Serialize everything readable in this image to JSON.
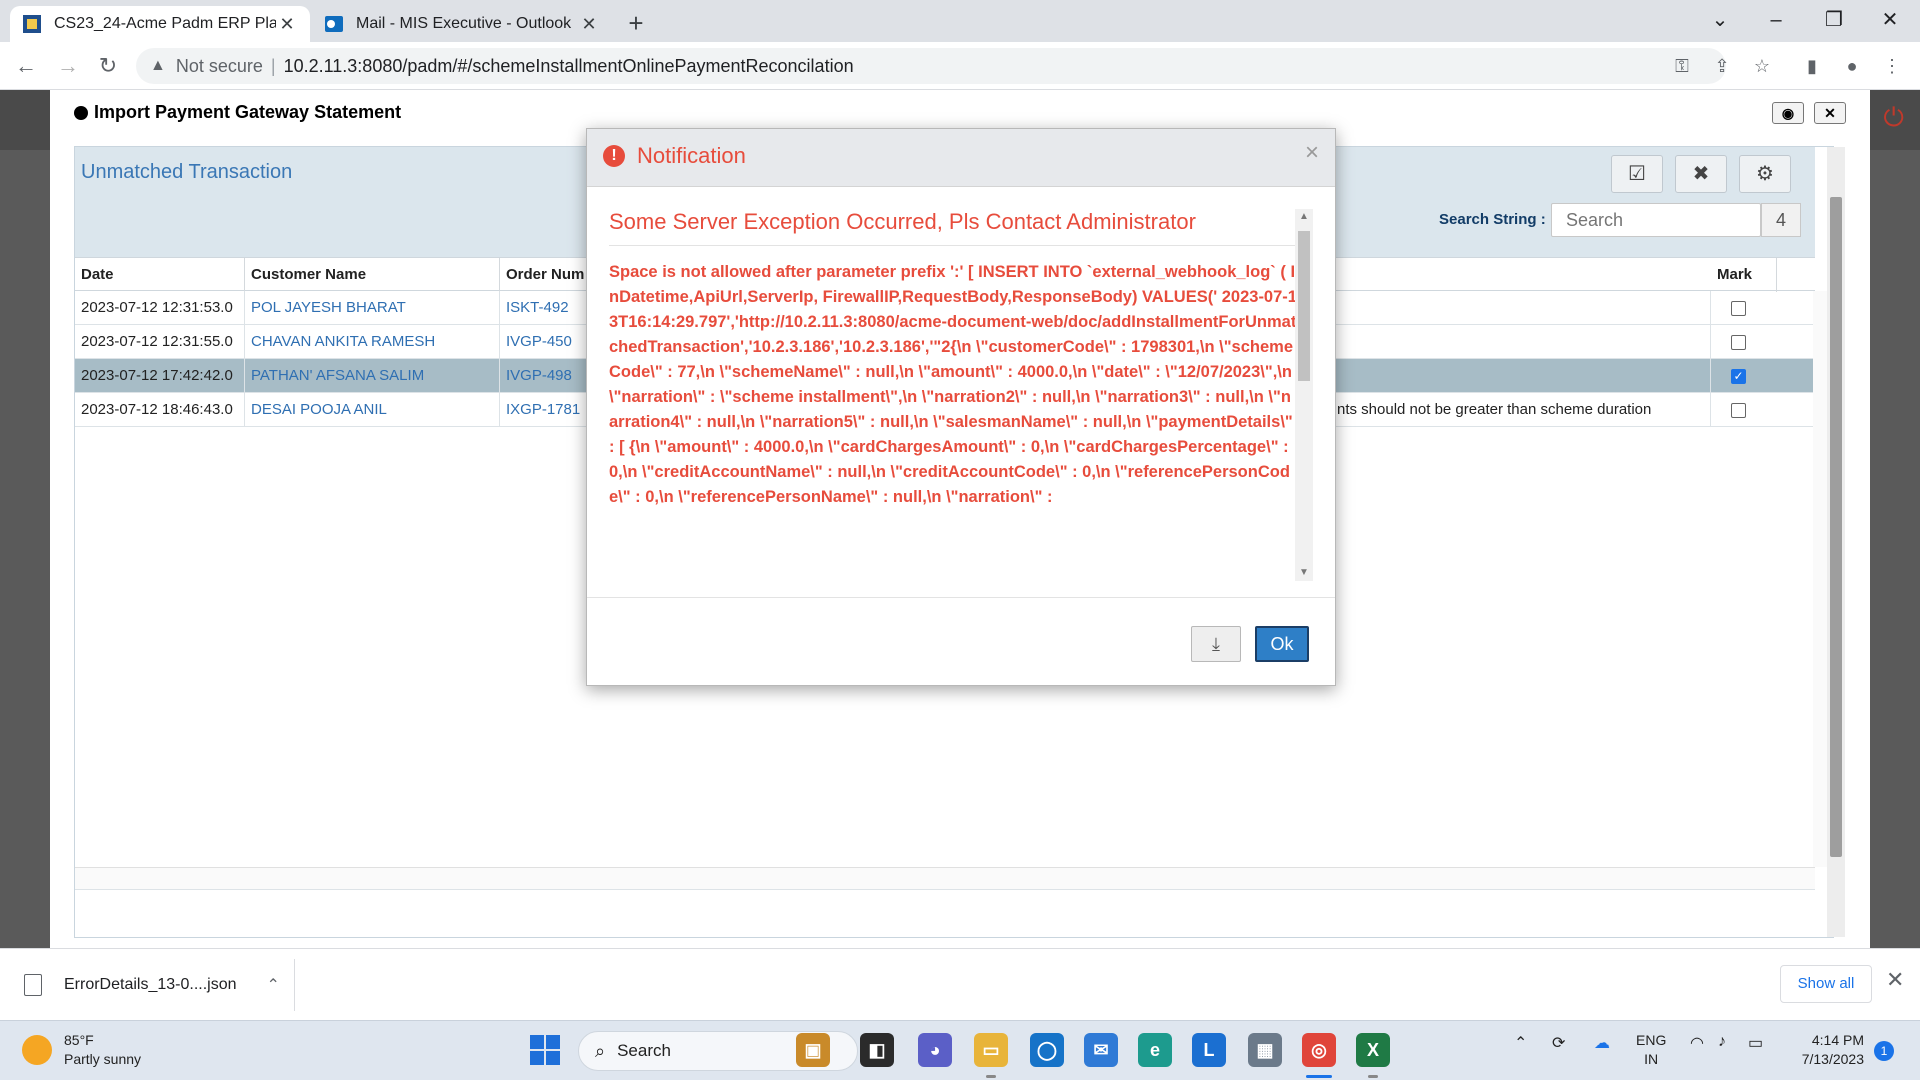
{
  "browser": {
    "tabs": [
      {
        "title": "CS23_24-Acme Padm ERP Platform",
        "active": true
      },
      {
        "title": "Mail - MIS Executive - Outlook",
        "active": false
      }
    ],
    "new_tab": "+",
    "address": {
      "security": "Not secure",
      "url": "10.2.11.3:8080/padm/#/schemeInstallmentOnlinePaymentReconcilation"
    }
  },
  "panel": {
    "title": "Import Payment Gateway Statement",
    "section_title": "Unmatched Transaction",
    "search": {
      "label": "Search String :",
      "placeholder": "Search",
      "count": "4"
    },
    "columns": {
      "date": "Date",
      "customer": "Customer Name",
      "order": "Order Num",
      "mark": "Mark"
    },
    "rows": [
      {
        "date": "2023-07-12 12:31:53.0",
        "customer": "POL JAYESH BHARAT",
        "order": "ISKT-492",
        "remark": "",
        "checked": false,
        "selected": false
      },
      {
        "date": "2023-07-12 12:31:55.0",
        "customer": "CHAVAN ANKITA RAMESH",
        "order": "IVGP-450",
        "remark": "",
        "checked": false,
        "selected": false
      },
      {
        "date": "2023-07-12 17:42:42.0",
        "customer": "PATHAN' AFSANA SALIM",
        "order": "IVGP-498",
        "remark": "",
        "checked": true,
        "selected": true
      },
      {
        "date": "2023-07-12 18:46:43.0",
        "customer": "DESAI POOJA ANIL",
        "order": "IXGP-1781",
        "remark": "nts should not be greater than scheme duration",
        "checked": false,
        "selected": false
      }
    ]
  },
  "modal": {
    "title": "Notification",
    "heading": "Some Server Exception Occurred, Pls Contact Administrator",
    "message": "Space is not allowed after parameter prefix ':' [ INSERT INTO `external_webhook_log` ( InDatetime,ApiUrl,ServerIp, FirewallIP,RequestBody,ResponseBody) VALUES(' 2023-07-13T16:14:29.797','http://10.2.11.3:8080/acme-document-web/doc/addInstallmentForUnmatchedTransaction','10.2.3.186','10.2.3.186','\"2{\\n \\\"customerCode\\\" : 1798301,\\n \\\"schemeCode\\\" : 77,\\n \\\"schemeName\\\" : null,\\n \\\"amount\\\" : 4000.0,\\n \\\"date\\\" : \\\"12/07/2023\\\",\\n \\\"narration\\\" : \\\"scheme installment\\\",\\n \\\"narration2\\\" : null,\\n \\\"narration3\\\" : null,\\n \\\"narration4\\\" : null,\\n \\\"narration5\\\" : null,\\n \\\"salesmanName\\\" : null,\\n \\\"paymentDetails\\\" : [ {\\n \\\"amount\\\" : 4000.0,\\n \\\"cardChargesAmount\\\" : 0,\\n \\\"cardChargesPercentage\\\" : 0,\\n \\\"creditAccountName\\\" : null,\\n \\\"creditAccountCode\\\" : 0,\\n \\\"referencePersonCode\\\" : 0,\\n \\\"referencePersonName\\\" : null,\\n \\\"narration\\\" :",
    "ok_label": "Ok"
  },
  "downloads": {
    "file": "ErrorDetails_13-0....json",
    "show_all": "Show all"
  },
  "taskbar": {
    "weather_temp": "85°F",
    "weather_desc": "Partly sunny",
    "search_label": "Search",
    "lang_1": "ENG",
    "lang_2": "IN",
    "time": "4:14 PM",
    "date": "7/13/2023",
    "notifications": "1"
  },
  "colors": {
    "accent": "#2e7fc7",
    "error": "#e74c3c",
    "link": "#2f6fb2",
    "selected_row": "#a7bcc6"
  }
}
